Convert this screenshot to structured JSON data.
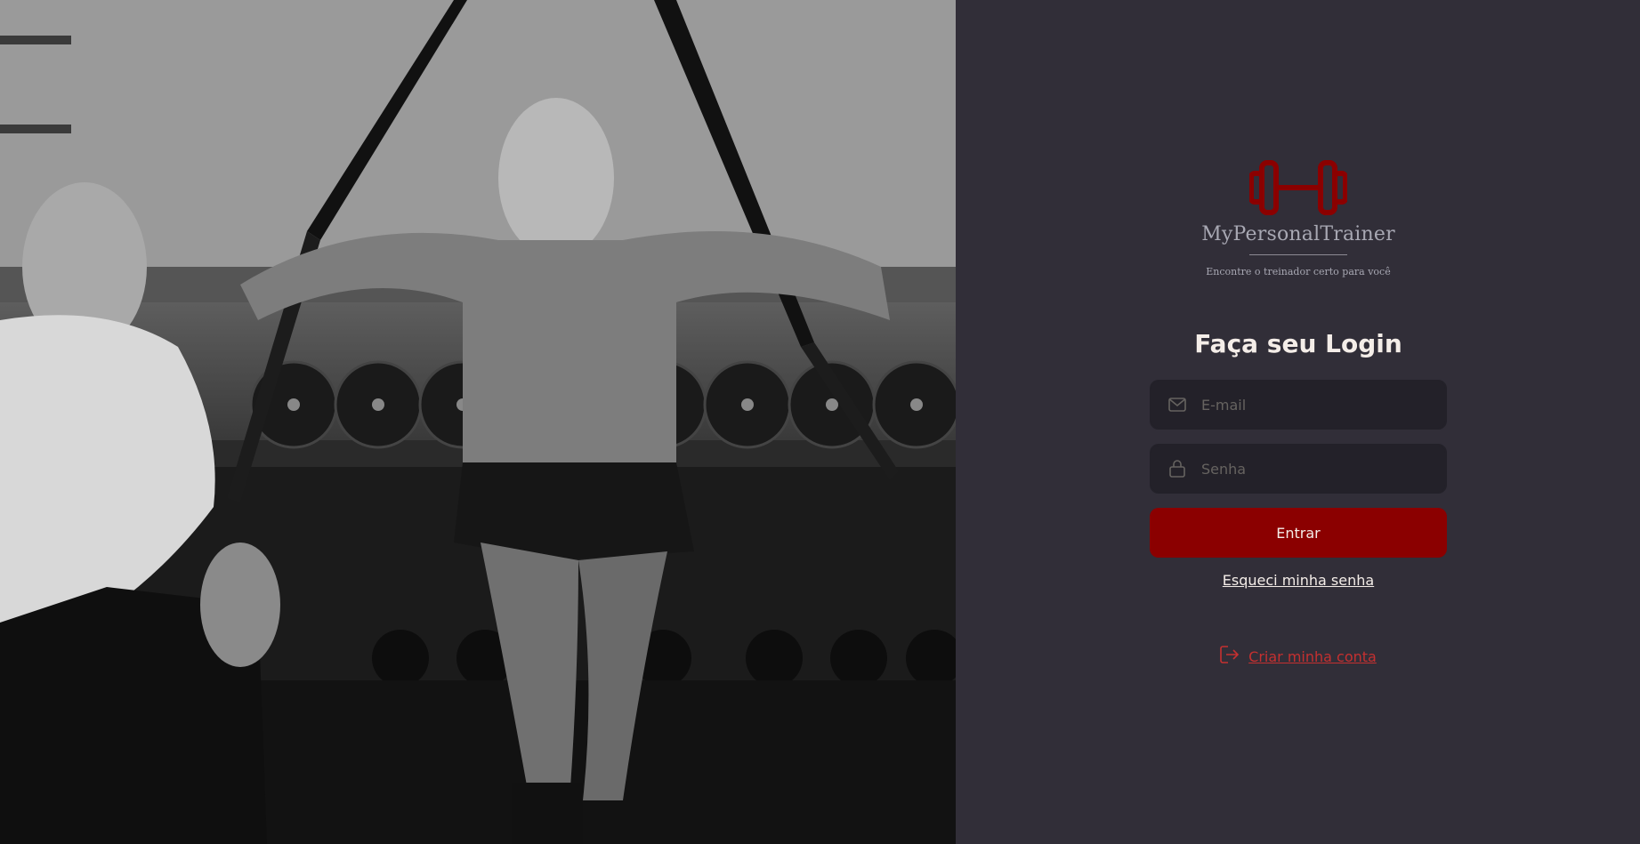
{
  "hero": {
    "alt_icon": "gym-training-photo"
  },
  "brand": {
    "name": "MyPersonalTrainer",
    "tagline": "Encontre o treinador certo para você",
    "icon": "dumbbell-icon",
    "accent_color": "#8b0000"
  },
  "form": {
    "title": "Faça seu Login",
    "email": {
      "placeholder": "E-mail",
      "value": "",
      "icon": "mail-icon"
    },
    "password": {
      "placeholder": "Senha",
      "value": "",
      "icon": "lock-icon"
    },
    "submit_label": "Entrar",
    "forgot_label": "Esqueci minha senha"
  },
  "signup": {
    "label": "Criar minha conta",
    "icon": "log-in-icon",
    "color": "#c53030"
  },
  "colors": {
    "background": "#312e38",
    "input_bg": "#232129",
    "text": "#f4ede8",
    "muted": "#a8a8b3"
  }
}
